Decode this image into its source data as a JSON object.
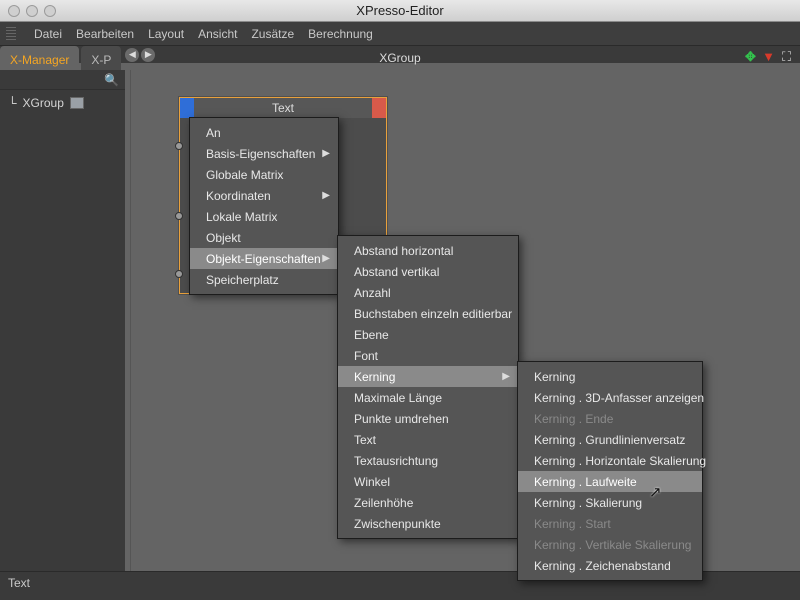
{
  "window": {
    "title": "XPresso-Editor"
  },
  "menubar": {
    "items": [
      "Datei",
      "Bearbeiten",
      "Layout",
      "Ansicht",
      "Zusätze",
      "Berechnung"
    ]
  },
  "tabs": {
    "left_active": "X-Manager",
    "left_inactive": "X-P",
    "center": "XGroup"
  },
  "sidebar": {
    "tree_item": "XGroup"
  },
  "node": {
    "title": "Text"
  },
  "footer": {
    "text": "Text"
  },
  "menu1": {
    "items": [
      {
        "label": "An",
        "disabled": false,
        "arrow": false
      },
      {
        "label": "Basis-Eigenschaften",
        "disabled": false,
        "arrow": true
      },
      {
        "label": "Globale Matrix",
        "disabled": false,
        "arrow": false
      },
      {
        "label": "Koordinaten",
        "disabled": false,
        "arrow": true
      },
      {
        "label": "Lokale Matrix",
        "disabled": false,
        "arrow": false
      },
      {
        "label": "Objekt",
        "disabled": false,
        "arrow": false
      },
      {
        "label": "Objekt-Eigenschaften",
        "disabled": false,
        "arrow": true,
        "sel": true
      },
      {
        "label": "Speicherplatz",
        "disabled": false,
        "arrow": false
      }
    ]
  },
  "menu2": {
    "items": [
      {
        "label": "Abstand horizontal"
      },
      {
        "label": "Abstand vertikal"
      },
      {
        "label": "Anzahl"
      },
      {
        "label": "Buchstaben einzeln editierbar"
      },
      {
        "label": "Ebene"
      },
      {
        "label": "Font"
      },
      {
        "label": "Kerning",
        "arrow": true,
        "sel": true
      },
      {
        "label": "Maximale Länge"
      },
      {
        "label": "Punkte umdrehen"
      },
      {
        "label": "Text"
      },
      {
        "label": "Textausrichtung"
      },
      {
        "label": "Winkel"
      },
      {
        "label": "Zeilenhöhe"
      },
      {
        "label": "Zwischenpunkte"
      }
    ]
  },
  "menu3": {
    "items": [
      {
        "label": "Kerning"
      },
      {
        "label": "Kerning . 3D-Anfasser anzeigen"
      },
      {
        "label": "Kerning . Ende",
        "disabled": true
      },
      {
        "label": "Kerning . Grundlinienversatz"
      },
      {
        "label": "Kerning . Horizontale Skalierung"
      },
      {
        "label": "Kerning . Laufweite",
        "sel": true
      },
      {
        "label": "Kerning . Skalierung"
      },
      {
        "label": "Kerning . Start",
        "disabled": true
      },
      {
        "label": "Kerning . Vertikale Skalierung",
        "disabled": true
      },
      {
        "label": "Kerning . Zeichenabstand"
      }
    ]
  }
}
